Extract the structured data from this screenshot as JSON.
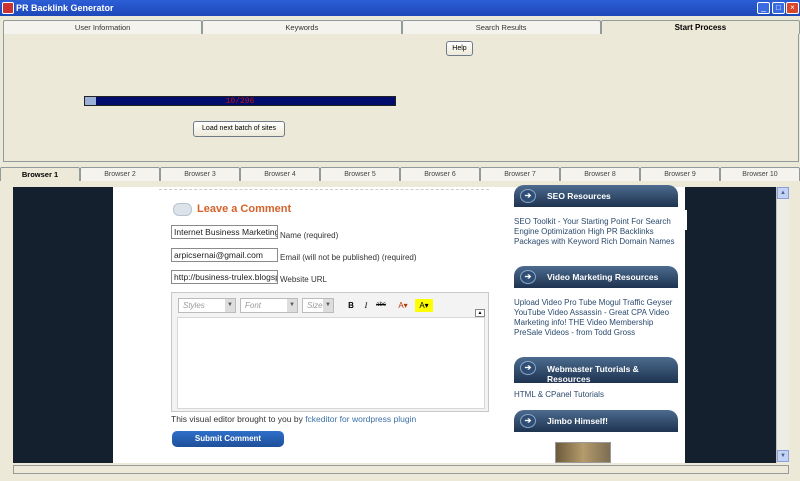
{
  "window": {
    "title": "PR Backlink Generator"
  },
  "top_tabs": [
    {
      "label": "User Information"
    },
    {
      "label": "Keywords"
    },
    {
      "label": "Search Results"
    },
    {
      "label": "Start Process"
    }
  ],
  "top_tabs_active_index": 3,
  "process": {
    "help_label": "Help",
    "progress_text": "10/296",
    "progress_fraction": 0.034,
    "load_next_label": "Load next batch of sites"
  },
  "browser_tabs": [
    {
      "label": "Browser 1"
    },
    {
      "label": "Browser 2"
    },
    {
      "label": "Browser 3"
    },
    {
      "label": "Browser 4"
    },
    {
      "label": "Browser 5"
    },
    {
      "label": "Browser 6"
    },
    {
      "label": "Browser 7"
    },
    {
      "label": "Browser 8"
    },
    {
      "label": "Browser 9"
    },
    {
      "label": "Browser 10"
    }
  ],
  "browser_tabs_active_index": 0,
  "comment_form": {
    "title": "Leave a Comment",
    "name_value": "Internet Business Marketing",
    "name_label": "Name (required)",
    "email_value": "arpicsernai@gmail.com",
    "email_label": "Email (will not be published) (required)",
    "website_value": "http://business-trulex.blogspot.com",
    "website_label": "Website URL",
    "editor": {
      "styles_label": "Styles",
      "font_label": "Font",
      "size_label": "Size",
      "bold": "B",
      "italic": "I",
      "strike": "abc",
      "text_color": "A",
      "bg_color": "A"
    },
    "note_prefix": "This visual editor brought to you by ",
    "note_link": "fckeditor for wordpress plugin",
    "submit_label": "Submit Comment"
  },
  "sidebar": {
    "sections": [
      {
        "title": "SEO Resources",
        "body": "SEO Toolkit - Your Starting Point For Search Engine Optimization High PR Backlinks Packages with Keyword Rich Domain Names"
      },
      {
        "title": "Video Marketing Resources",
        "body": "Upload Video Pro Tube Mogul Traffic Geyser YouTube Video Assassin - Great CPA Video Marketing info! THE Video Membership PreSale Videos - from Todd Gross"
      },
      {
        "title": "Webmaster Tutorials & Resources",
        "body": "HTML & CPanel Tutorials"
      },
      {
        "title": "Jimbo Himself!",
        "body": ""
      }
    ]
  },
  "colors": {
    "titlebar": "#2c5ed6",
    "progress_bg": "#000c6b",
    "progress_text": "#c01414",
    "comment_title": "#d4622a",
    "submit_bg": "#1d4f99",
    "sidebar_header": "#1e3350",
    "page_bg": "#14202e"
  },
  "icons": {
    "app": "app-icon",
    "minimize": "minimize-icon",
    "maximize": "maximize-icon",
    "close": "close-icon",
    "section_arrow": "arrow-right-icon",
    "comment_bubble": "speech-bubble-icon"
  }
}
